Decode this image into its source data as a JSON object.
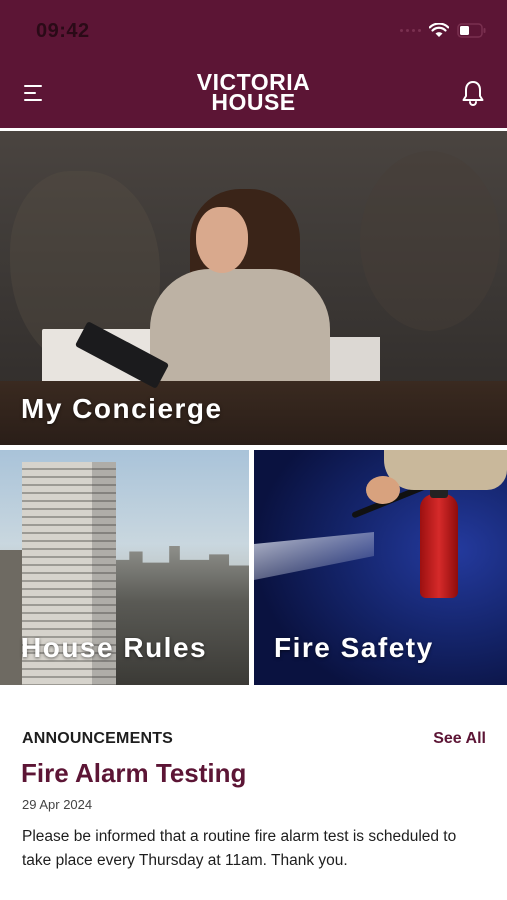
{
  "status_bar": {
    "time": "09:42"
  },
  "header": {
    "brand_line1": "VICTORIA",
    "brand_line2": "HOUSE",
    "background_color": "#5c1535"
  },
  "tiles": {
    "concierge": {
      "label": "My Concierge"
    },
    "house_rules": {
      "label": "House Rules"
    },
    "fire_safety": {
      "label": "Fire Safety"
    }
  },
  "announcements": {
    "heading": "ANNOUNCEMENTS",
    "see_all": "See All",
    "items": [
      {
        "title": "Fire Alarm Testing",
        "date": "29 Apr 2024",
        "body": "Please be informed that a routine fire alarm test is scheduled to take place every Thursday at 11am. Thank you."
      }
    ]
  },
  "colors": {
    "accent": "#5c1535",
    "text": "#1e1e1e"
  },
  "icons": [
    "menu-icon",
    "bell-icon",
    "wifi-icon",
    "battery-icon",
    "signal-icon"
  ]
}
